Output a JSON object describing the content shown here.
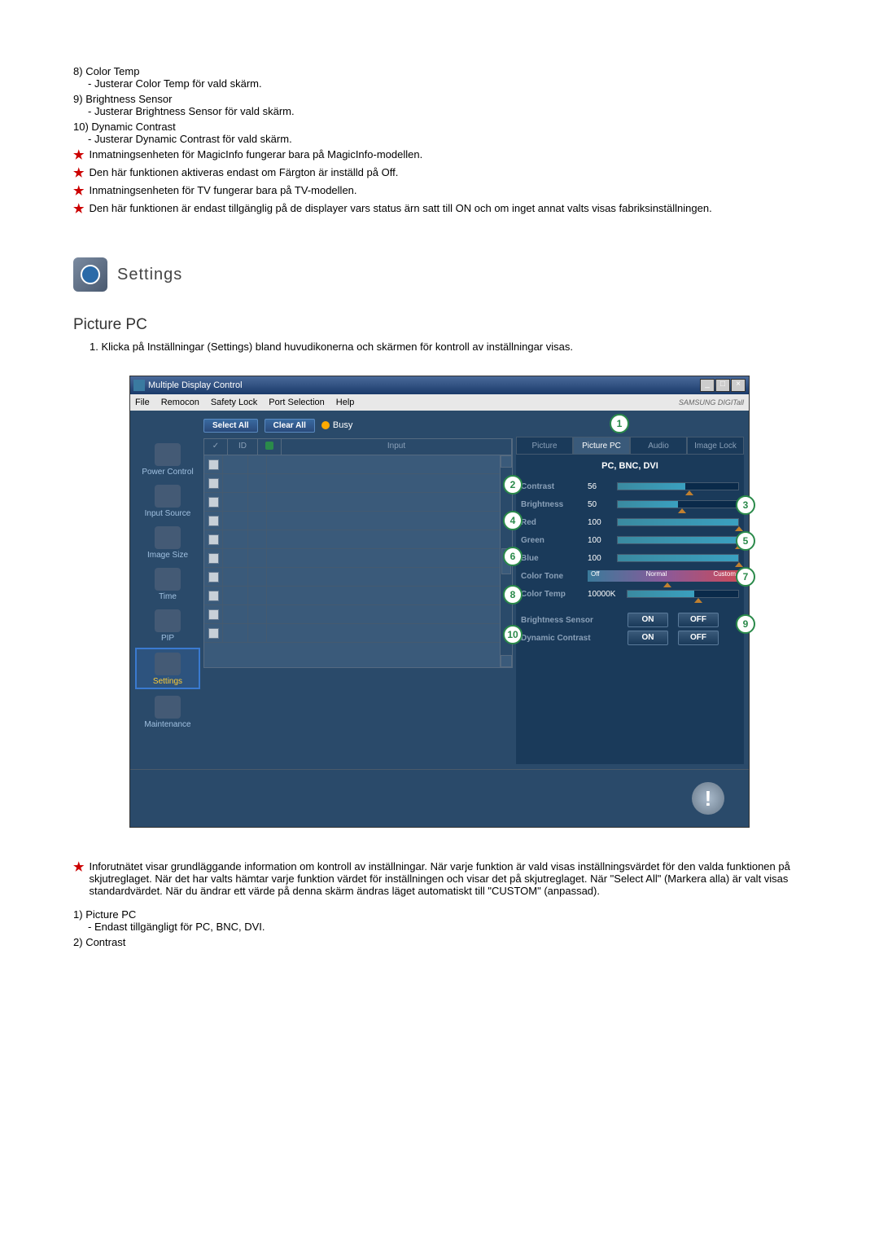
{
  "top_items": [
    {
      "num": "8)",
      "title": "Color Temp",
      "desc": "- Justerar Color Temp för vald skärm."
    },
    {
      "num": "9)",
      "title": "Brightness Sensor",
      "desc": "- Justerar Brightness Sensor för vald skärm."
    },
    {
      "num": "10)",
      "title": "Dynamic Contrast",
      "desc": "- Justerar Dynamic Contrast för vald skärm."
    }
  ],
  "star_notes_top": [
    "Inmatningsenheten för MagicInfo fungerar bara på MagicInfo-modellen.",
    "Den här funktionen aktiveras endast om Färgton är inställd på Off.",
    "Inmatningsenheten för TV fungerar bara på TV-modellen.",
    "Den här funktionen är endast tillgänglig på de displayer vars status ärn satt till ON och om inget annat valts visas fabriksinställningen."
  ],
  "section_title": "Settings",
  "page_heading": "Picture PC",
  "step_1": "1. Klicka på Inställningar (Settings) bland huvudikonerna och skärmen för kontroll av inställningar visas.",
  "window": {
    "title": "Multiple Display Control",
    "menu": [
      "File",
      "Remocon",
      "Safety Lock",
      "Port Selection",
      "Help"
    ],
    "brand": "SAMSUNG DIGITall",
    "sidebar": [
      {
        "label": "Power Control"
      },
      {
        "label": "Input Source"
      },
      {
        "label": "Image Size"
      },
      {
        "label": "Time"
      },
      {
        "label": "PIP"
      },
      {
        "label": "Settings"
      },
      {
        "label": "Maintenance"
      }
    ],
    "toolbar": {
      "select_all": "Select All",
      "clear_all": "Clear All",
      "busy": "Busy"
    },
    "grid_headers": {
      "check": "✓",
      "id": "ID",
      "status": "",
      "input": "Input"
    },
    "tabs": [
      "Picture",
      "Picture PC",
      "Audio",
      "Image Lock"
    ],
    "panel_sub": "PC, BNC, DVI",
    "controls": {
      "contrast": {
        "label": "Contrast",
        "value": "56"
      },
      "brightness": {
        "label": "Brightness",
        "value": "50"
      },
      "red": {
        "label": "Red",
        "value": "100"
      },
      "green": {
        "label": "Green",
        "value": "100"
      },
      "blue": {
        "label": "Blue",
        "value": "100"
      },
      "color_tone": {
        "label": "Color Tone",
        "off": "Off",
        "normal": "Normal",
        "custom": "Custom"
      },
      "color_temp": {
        "label": "Color Temp",
        "value": "10000K"
      },
      "brightness_sensor": {
        "label": "Brightness Sensor",
        "on": "ON",
        "off": "OFF"
      },
      "dynamic_contrast": {
        "label": "Dynamic Contrast",
        "on": "ON",
        "off": "OFF"
      }
    }
  },
  "callouts": {
    "1": "1",
    "2": "2",
    "3": "3",
    "4": "4",
    "5": "5",
    "6": "6",
    "7": "7",
    "8": "8",
    "9": "9",
    "10": "10"
  },
  "body_note": "Inforutnätet visar grundläggande information om kontroll av inställningar. När varje funktion är vald visas inställningsvärdet för den valda funktionen på skjutreglaget. När det har valts hämtar varje funktion värdet för inställningen och visar det på skjutreglaget. När \"Select All\" (Markera alla) är valt visas standardvärdet. När du ändrar ett värde på denna skärm ändras läget automatiskt till \"CUSTOM\" (anpassad).",
  "bottom_items": [
    {
      "num": "1)",
      "title": "Picture PC",
      "desc": "- Endast tillgängligt för PC, BNC, DVI."
    },
    {
      "num": "2)",
      "title": "Contrast",
      "desc": ""
    }
  ]
}
